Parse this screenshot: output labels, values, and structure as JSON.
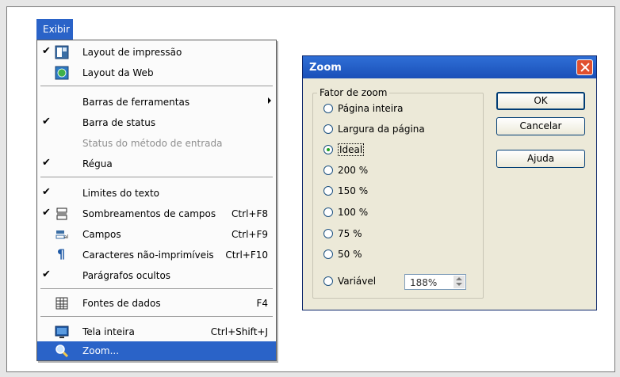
{
  "menu": {
    "title": "Exibir",
    "items": [
      {
        "label": "Layout de impressão",
        "checked": true,
        "icon": "print-layout-icon"
      },
      {
        "label": "Layout da Web",
        "checked": false,
        "icon": "web-layout-icon"
      },
      {
        "label": "Barras de ferramentas",
        "submenu": true
      },
      {
        "label": "Barra de status",
        "checked": true
      },
      {
        "label": "Status do método de entrada",
        "disabled": true
      },
      {
        "label": "Régua",
        "checked": true
      },
      {
        "label": "Limites do texto",
        "checked": true
      },
      {
        "label": "Sombreamentos de campos",
        "shortcut": "Ctrl+F8",
        "checked": true,
        "icon": "field-shading-icon"
      },
      {
        "label": "Campos",
        "shortcut": "Ctrl+F9",
        "icon": "fields-icon"
      },
      {
        "label": "Caracteres não-imprimíveis",
        "shortcut": "Ctrl+F10",
        "icon": "pilcrow-icon"
      },
      {
        "label": "Parágrafos ocultos",
        "checked": true
      },
      {
        "label": "Fontes de dados",
        "shortcut": "F4",
        "icon": "data-sources-icon"
      },
      {
        "label": "Tela inteira",
        "shortcut": "Ctrl+Shift+J",
        "icon": "full-screen-icon"
      },
      {
        "label": "Zoom...",
        "selected": true,
        "icon": "magnifier-icon"
      }
    ]
  },
  "dialog": {
    "title": "Zoom",
    "group_label": "Fator de zoom",
    "options": [
      {
        "label": "Página inteira",
        "selected": false
      },
      {
        "label": "Largura da página",
        "selected": false
      },
      {
        "label": "Ideal",
        "selected": true
      },
      {
        "label": "200 %",
        "selected": false
      },
      {
        "label": "150 %",
        "selected": false
      },
      {
        "label": "100 %",
        "selected": false
      },
      {
        "label": "75 %",
        "selected": false
      },
      {
        "label": "50 %",
        "selected": false
      },
      {
        "label": "Variável",
        "selected": false
      }
    ],
    "variable_value": "188%",
    "buttons": {
      "ok": "OK",
      "cancel": "Cancelar",
      "help": "Ajuda"
    }
  },
  "colors": {
    "highlight": "#2a63c8",
    "dialog_bg": "#ece9d8",
    "close": "#e0502f"
  }
}
